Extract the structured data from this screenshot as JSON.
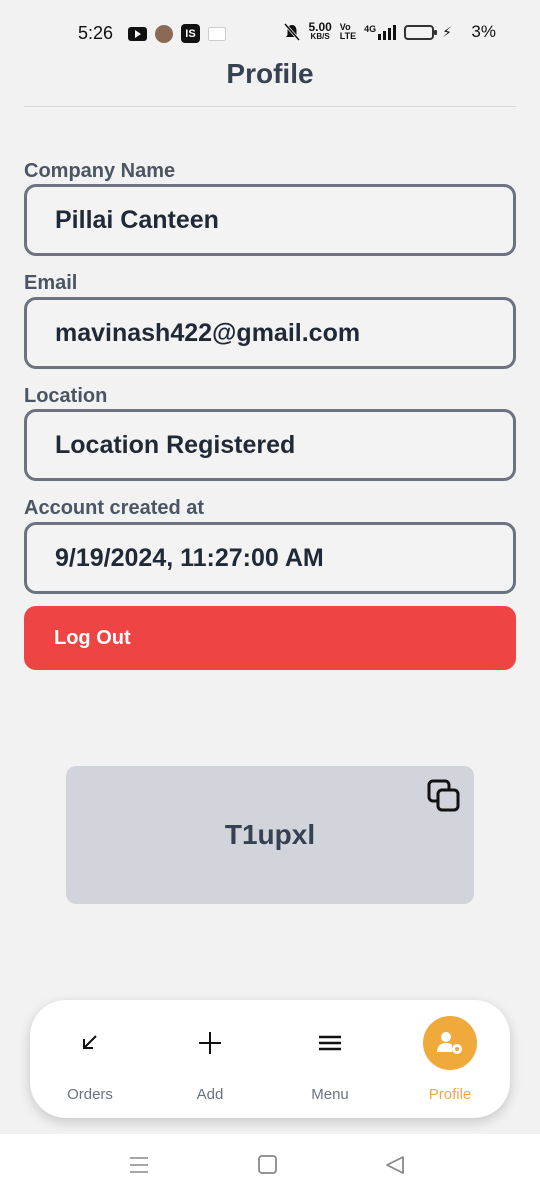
{
  "status_bar": {
    "time": "5:26",
    "net_speed_value": "5.00",
    "net_speed_unit": "KB/S",
    "volte_top": "Vo",
    "volte_bottom": "LTE",
    "network": "4G",
    "battery_pct": "3%",
    "badge_text": "IS"
  },
  "header": {
    "title": "Profile"
  },
  "form": {
    "company": {
      "label": "Company Name",
      "value": "Pillai Canteen"
    },
    "email": {
      "label": "Email",
      "value": "mavinash422@gmail.com"
    },
    "location": {
      "label": "Location",
      "value": "Location Registered"
    },
    "created": {
      "label": "Account created at",
      "value": "9/19/2024, 11:27:00 AM"
    }
  },
  "logout_label": "Log Out",
  "code_card": {
    "code": "T1upxl"
  },
  "bottom_nav": {
    "items": [
      {
        "label": "Orders",
        "icon": "arrow-down-left-icon"
      },
      {
        "label": "Add",
        "icon": "plus-icon"
      },
      {
        "label": "Menu",
        "icon": "menu-icon"
      },
      {
        "label": "Profile",
        "icon": "user-gear-icon",
        "active": true
      }
    ]
  },
  "colors": {
    "accent": "#f0a93b",
    "logout": "#ef4444",
    "card": "#d1d5db",
    "border": "#6b7280"
  }
}
